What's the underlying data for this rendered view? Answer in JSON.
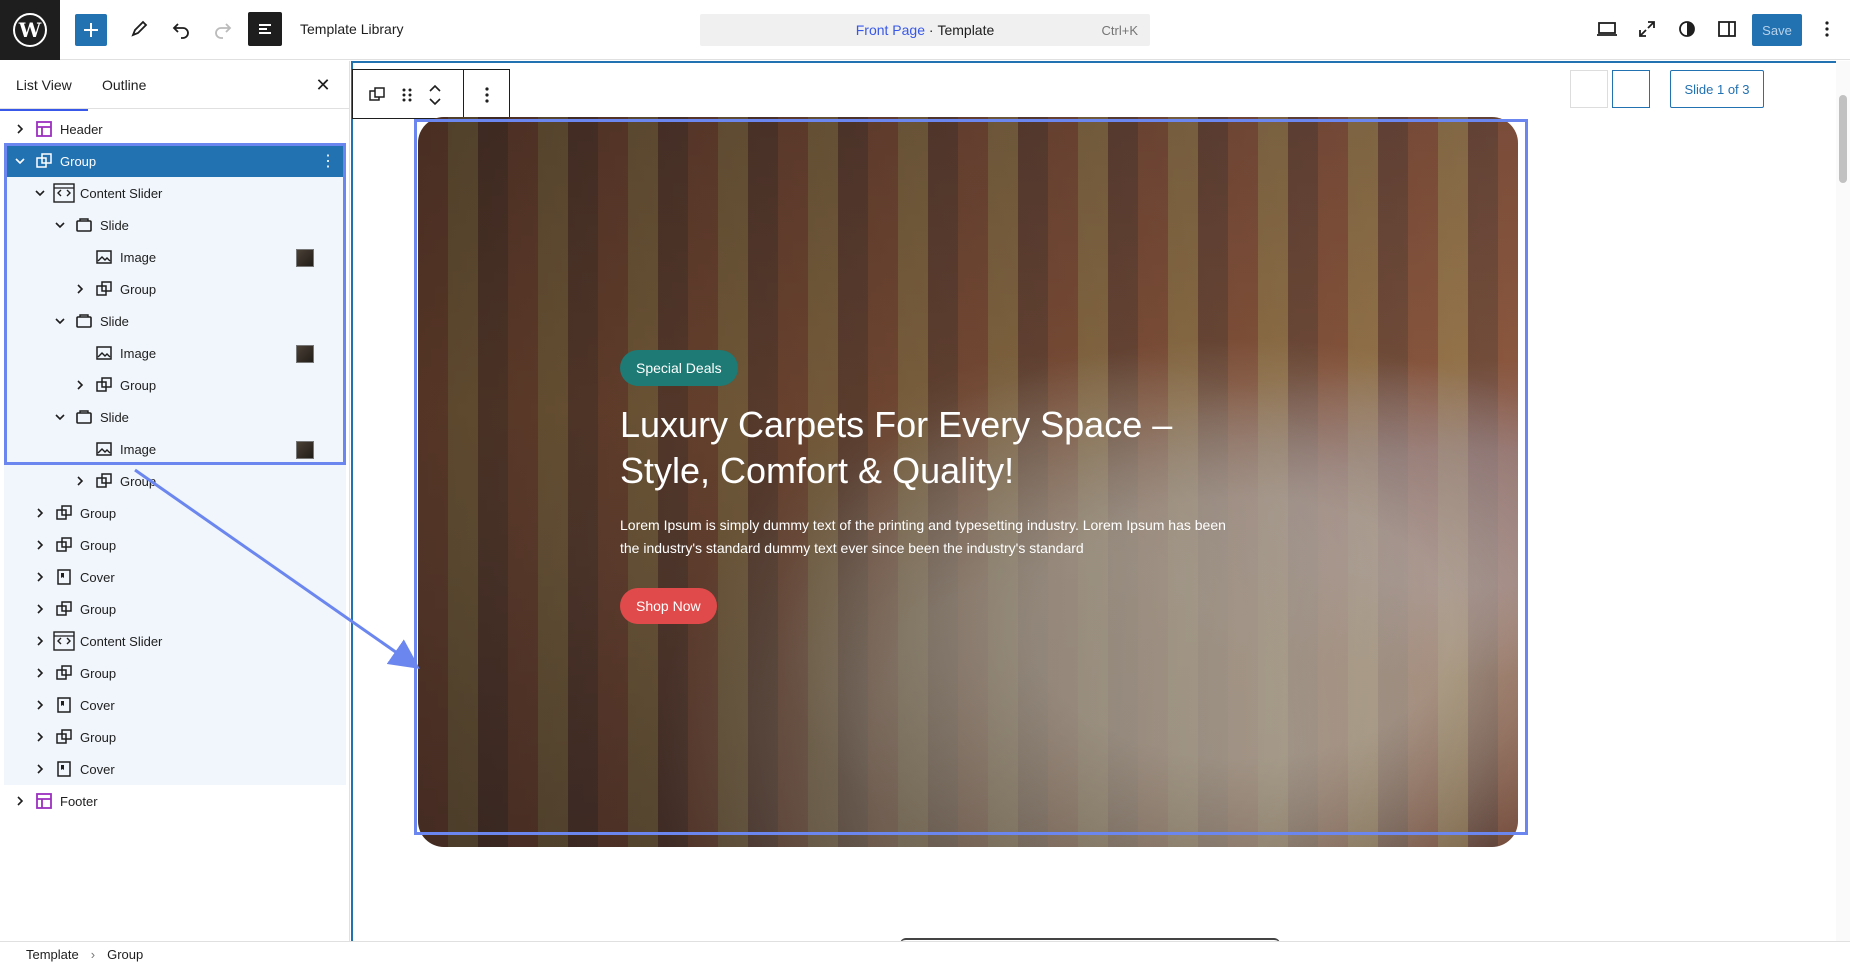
{
  "topbar": {
    "doc_title": "Template Library",
    "command": {
      "page": "Front Page",
      "separator": " · ",
      "type": "Template",
      "shortcut": "Ctrl+K"
    },
    "save_label": "Save"
  },
  "sidebar": {
    "tabs": [
      "List View",
      "Outline"
    ],
    "rows": [
      {
        "label": "Header",
        "icon": "template-part",
        "chev": "right",
        "depth": 0
      },
      {
        "label": "Group",
        "icon": "group",
        "chev": "down",
        "depth": 0,
        "selected": true
      },
      {
        "label": "Content Slider",
        "icon": "slider",
        "chev": "down",
        "depth": 1
      },
      {
        "label": "Slide",
        "icon": "slide",
        "chev": "down",
        "depth": 2
      },
      {
        "label": "Image",
        "icon": "image",
        "chev": "none",
        "depth": 3,
        "thumb": true
      },
      {
        "label": "Group",
        "icon": "group",
        "chev": "right",
        "depth": 3
      },
      {
        "label": "Slide",
        "icon": "slide",
        "chev": "down",
        "depth": 2
      },
      {
        "label": "Image",
        "icon": "image",
        "chev": "none",
        "depth": 3,
        "thumb": true
      },
      {
        "label": "Group",
        "icon": "group",
        "chev": "right",
        "depth": 3
      },
      {
        "label": "Slide",
        "icon": "slide",
        "chev": "down",
        "depth": 2
      },
      {
        "label": "Image",
        "icon": "image",
        "chev": "none",
        "depth": 3,
        "thumb": true
      },
      {
        "label": "Group",
        "icon": "group",
        "chev": "right",
        "depth": 3
      },
      {
        "label": "Group",
        "icon": "group",
        "chev": "right",
        "depth": 1
      },
      {
        "label": "Group",
        "icon": "group",
        "chev": "right",
        "depth": 1
      },
      {
        "label": "Cover",
        "icon": "cover",
        "chev": "right",
        "depth": 1
      },
      {
        "label": "Group",
        "icon": "group",
        "chev": "right",
        "depth": 1
      },
      {
        "label": "Content Slider",
        "icon": "slider",
        "chev": "right",
        "depth": 1
      },
      {
        "label": "Group",
        "icon": "group",
        "chev": "right",
        "depth": 1
      },
      {
        "label": "Cover",
        "icon": "cover",
        "chev": "right",
        "depth": 1
      },
      {
        "label": "Group",
        "icon": "group",
        "chev": "right",
        "depth": 1
      },
      {
        "label": "Cover",
        "icon": "cover",
        "chev": "right",
        "depth": 1
      },
      {
        "label": "Footer",
        "icon": "template-part",
        "chev": "right",
        "depth": 0
      }
    ]
  },
  "canvas": {
    "slide_label": "Slide 1 of 3",
    "hero": {
      "badge": "Special Deals",
      "title": "Luxury Carpets For Every Space – Style, Comfort & Quality!",
      "text": "Lorem Ipsum is simply dummy text of the printing and typesetting industry. Lorem Ipsum has been the industry's standard dummy text ever since been the industry's standard",
      "button": "Shop Now"
    }
  },
  "breadcrumb": [
    "Template",
    "Group"
  ],
  "colors": {
    "accent": "#2271b1",
    "selection": "#6b86ee",
    "badge": "#1d7a74",
    "cta": "#e14a4a",
    "template_part": "#9b2fbf"
  }
}
